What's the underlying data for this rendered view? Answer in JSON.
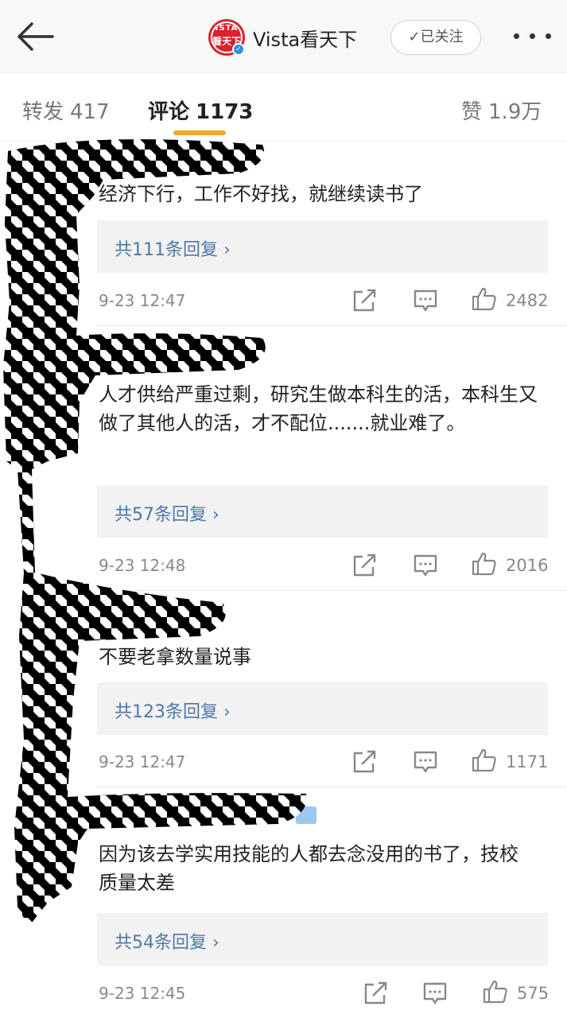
{
  "header": {
    "back_icon": "arrow-left-icon",
    "avatar_text_top": "ISTA",
    "avatar_text_bottom": "看天下",
    "account_name": "Vista看天下",
    "follow_label": "✓已关注",
    "more_icon": "more-dots-icon"
  },
  "tabs": [
    {
      "label": "转发",
      "count": "417"
    },
    {
      "label": "评论",
      "count": "1173"
    },
    {
      "label": "赞",
      "count": "1.9万"
    }
  ],
  "comments": [
    {
      "text": "经济下行，工作不好找，就继续读书了",
      "replies": "共111条回复 ›",
      "time": "9-23 12:47",
      "likes": "2482"
    },
    {
      "text": "人才供给严重过剩，研究生做本科生的活，本科生又做了其他人的活，才不配位.......就业难了。",
      "replies": "共57条回复 ›",
      "time": "9-23 12:48",
      "likes": "2016"
    },
    {
      "text": "不要老拿数量说事",
      "replies": "共123条回复 ›",
      "time": "9-23 12:47",
      "likes": "1171"
    },
    {
      "text": "因为该去学实用技能的人都去念没用的书了，技校质量太差",
      "replies": "共54条回复 ›",
      "time": "9-23 12:45",
      "likes": "575"
    }
  ],
  "icons": {
    "share": "share-icon",
    "comment": "comment-icon",
    "like": "thumbs-up-icon"
  },
  "colors": {
    "accent": "#f5a623",
    "link": "#4d78a8",
    "brand_red": "#d8232a"
  }
}
